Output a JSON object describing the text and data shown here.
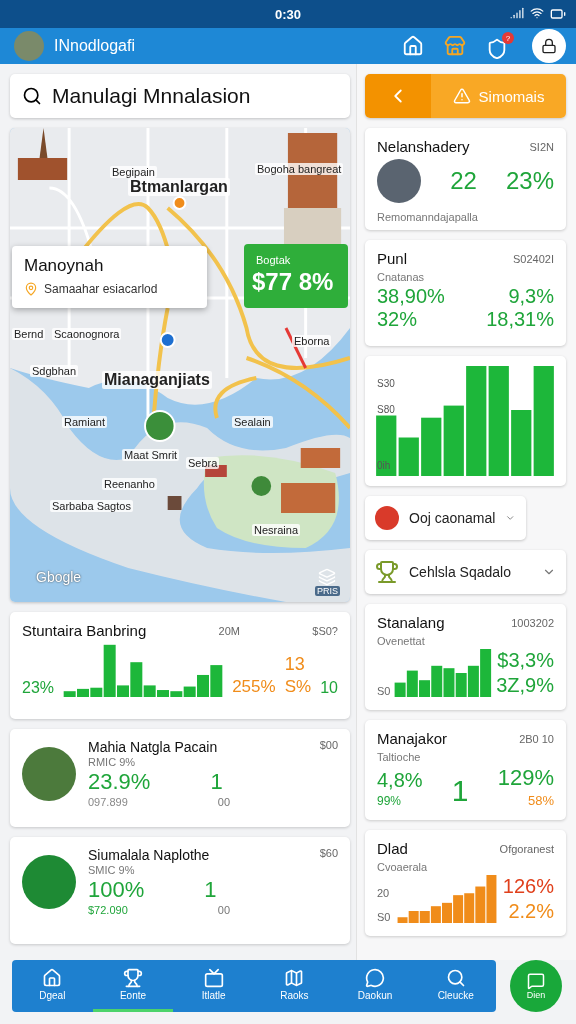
{
  "status_bar": {
    "time": "0:30"
  },
  "header": {
    "title": "INnodlogafi",
    "badge": "?"
  },
  "search": {
    "value": "Manulagi Mnnalasion"
  },
  "map": {
    "labels": [
      {
        "text": "Begipain",
        "kind": "small"
      },
      {
        "text": "Btmanlargan",
        "kind": "big"
      },
      {
        "text": "Bogoha bangreat",
        "kind": "small"
      },
      {
        "text": "Bernd",
        "kind": "small"
      },
      {
        "text": "Scaonognora",
        "kind": "small"
      },
      {
        "text": "Eborna",
        "kind": "small"
      },
      {
        "text": "Sdgbhan",
        "kind": "small"
      },
      {
        "text": "Mianaganjiats",
        "kind": "big"
      },
      {
        "text": "Ramiant",
        "kind": "small"
      },
      {
        "text": "Sealain",
        "kind": "small"
      },
      {
        "text": "Maat Smrit",
        "kind": "small"
      },
      {
        "text": "Sebra",
        "kind": "small"
      },
      {
        "text": "Reenanho",
        "kind": "small"
      },
      {
        "text": "Sarbaba Sagtos",
        "kind": "small"
      },
      {
        "text": "Nesraina",
        "kind": "small"
      }
    ],
    "info_popup": {
      "title": "Manoynah",
      "subtitle": "Samaahar esiacarlod"
    },
    "price_popup": {
      "label": "Bogtak",
      "value": "$77 8%"
    },
    "logo": "Gbogle",
    "layers_label": "PRIS"
  },
  "filter_bar": {
    "button": "Simomais"
  },
  "profile_card": {
    "title": "Nelanshadery",
    "meta": "SI2N",
    "values": [
      {
        "text": "22",
        "color": "#1fa53a"
      },
      {
        "text": "23%",
        "color": "#1fa53a"
      }
    ],
    "note": "Remomanndajapalla"
  },
  "stats_card": {
    "title": "Punl",
    "meta": "S02402I",
    "subtitle": "Cnatanas",
    "values": [
      {
        "text": "38,90%",
        "color": "#1fa53a"
      },
      {
        "text": "9,3%",
        "color": "#1fa53a"
      },
      {
        "text": "32%",
        "color": "#1fa53a"
      },
      {
        "text": "18,31%",
        "color": "#1fa53a"
      }
    ]
  },
  "bar_chart_card": {
    "ticks": [
      "S30",
      "S80",
      "0ih"
    ]
  },
  "dropdowns": [
    {
      "label": "Ooj caonamal",
      "kind": "badge"
    },
    {
      "label": "Cehlsla Sqadalo",
      "kind": "emblem"
    }
  ],
  "ranking_card": {
    "title": "Stuntaira Banbring",
    "meta": "20M",
    "corner": "$S0?",
    "values": [
      {
        "text": "23%",
        "color": "#1fa53a"
      },
      {
        "text": "255%",
        "color": "#f08c1a"
      },
      {
        "text": "13",
        "color": "#f08c1a"
      },
      {
        "text": "S%",
        "color": "#f08c1a"
      },
      {
        "text": "10",
        "color": "#1fa53a"
      }
    ]
  },
  "people": [
    {
      "name": "Mahia Natgla Pacain",
      "sub": "RMIC 9%",
      "value": "23.9%",
      "amount": {
        "text": "097.899",
        "color": "#888888"
      },
      "count": "1",
      "count_sub": "00",
      "corner": "$00"
    },
    {
      "name": "Siumalala Naplothe",
      "sub": "SMIC 9%",
      "value": "100%",
      "amount": {
        "text": "$72.090",
        "color": "#1fa53a"
      },
      "count": "1",
      "count_sub": "00",
      "corner": "$60"
    }
  ],
  "metric_cards": [
    {
      "kind": "bars",
      "title": "Stanalang",
      "meta": "1003202",
      "subtitle": "Ovenettat",
      "axis": [
        "S0"
      ],
      "values": [
        {
          "text": "$3,3%",
          "color": "#1fa53a"
        },
        {
          "text": "3Z,9%",
          "color": "#1fa53a"
        }
      ]
    },
    {
      "kind": "split",
      "title": "Manajakor",
      "meta": "2B0 10",
      "subtitle": "Taltioche",
      "values": [
        {
          "text": "4,8%",
          "color": "#1fa53a"
        },
        {
          "text": "99%",
          "color": "#1fa53a"
        },
        {
          "text": "1",
          "color": "#1fa53a"
        },
        {
          "text": "129%",
          "color": "#1fa53a"
        },
        {
          "text": "58%",
          "color": "#f08c1a"
        }
      ]
    },
    {
      "kind": "orange-bars",
      "title": "Dlad",
      "meta": "Ofgoranest",
      "subtitle": "Cvoaerala",
      "axis": [
        "20",
        "S0"
      ],
      "values": [
        {
          "text": "126%",
          "color": "#e0401c"
        },
        {
          "text": "2.2%",
          "color": "#f08c1a"
        }
      ]
    }
  ],
  "nav": [
    {
      "label": "Dgeal",
      "selected": false
    },
    {
      "label": "Eonte",
      "selected": true
    },
    {
      "label": "Itlatle",
      "selected": false
    },
    {
      "label": "Raoks",
      "selected": false
    },
    {
      "label": "Daokun",
      "selected": false
    },
    {
      "label": "Cleucke",
      "selected": false
    }
  ],
  "fab": {
    "label": "Dien"
  }
}
